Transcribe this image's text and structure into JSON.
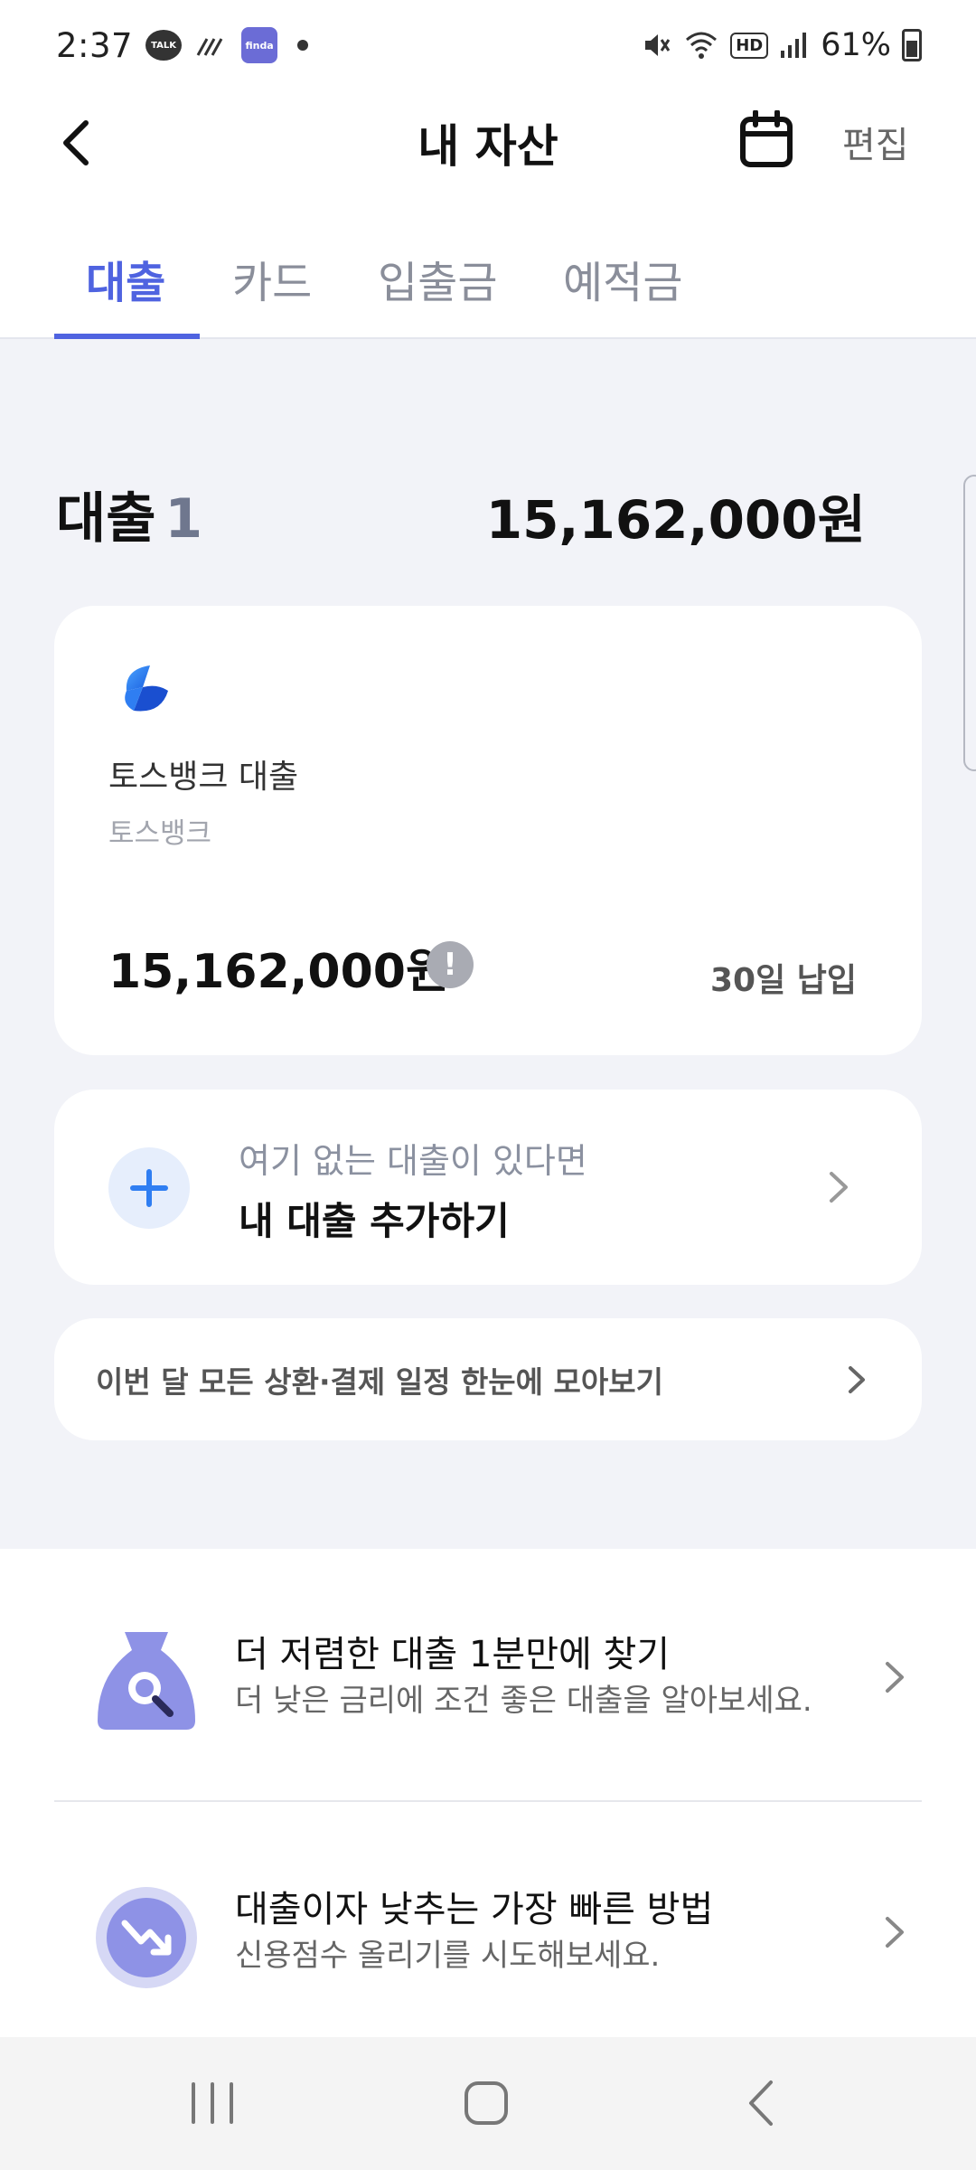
{
  "status_bar": {
    "time": "2:37",
    "talk_icon_label": "TALK",
    "app_icon_label": "finda",
    "hd_label": "HD",
    "battery": "61%"
  },
  "header": {
    "title": "내 자산",
    "edit_label": "편집"
  },
  "tabs": [
    {
      "label": "대출",
      "active": true
    },
    {
      "label": "카드",
      "active": false
    },
    {
      "label": "입출금",
      "active": false
    },
    {
      "label": "예적금",
      "active": false
    }
  ],
  "loan_summary": {
    "label": "대출",
    "count": "1",
    "total": "15,162,000원"
  },
  "loan_card": {
    "name": "토스뱅크 대출",
    "bank": "토스뱅크",
    "amount": "15,162,000원",
    "due": "30일 납입"
  },
  "add_loan": {
    "subtitle": "여기 없는 대출이 있다면",
    "title": "내 대출 추가하기"
  },
  "schedule": {
    "text": "이번 달 모든 상환·결제 일정 한눈에 모아보기"
  },
  "promos": [
    {
      "title": "더 저렴한 대출 1분만에 찾기",
      "desc": "더 낮은 금리에 조건 좋은 대출을 알아보세요."
    },
    {
      "title": "대출이자 낮추는 가장 빠른 방법",
      "desc": "신용점수 올리기를 시도해보세요."
    }
  ],
  "colors": {
    "accent": "#4f63e0",
    "background": "#f2f3f8",
    "icon_purple": "#8e92e6"
  }
}
